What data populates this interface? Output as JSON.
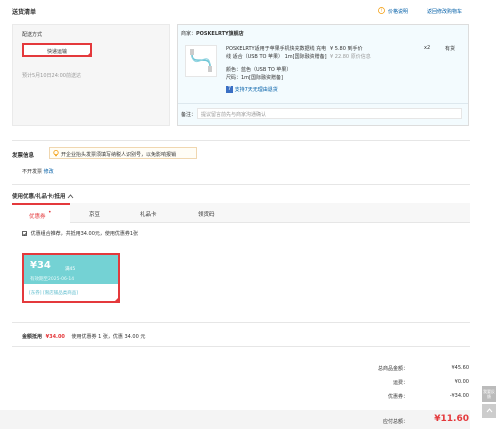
{
  "header": {
    "title": "送货清单",
    "price_note": "价格说明",
    "back_to_cart": "返回修改购物车"
  },
  "delivery": {
    "label": "配送方式",
    "method": "快递运输",
    "estimate": "预计5月10日24:00前送达"
  },
  "shop": {
    "label": "商家：",
    "name": "POSKELRTY旗舰店",
    "product": {
      "title_line1": "POSKELRTY适用于苹果手机快充数据线 充电",
      "title_line2": "线 适合（USB TO 苹果） 1m[国际融资赠备]",
      "color": "颜色：蓝色（USB TO 苹果）",
      "spec": "尺码：1m[国际融资赠备]",
      "return_policy": "支持7天无理由退货",
      "price": "¥ 5.80",
      "price_note": "到手价",
      "orig_price": "¥ 22.80",
      "orig_note": "原价信息",
      "qty": "x2",
      "stock": "有货"
    },
    "note_label": "备注：",
    "note_placeholder": "提议留言前先与商家沟通确认"
  },
  "invoice": {
    "title": "发票信息",
    "tip": "开企业抬头发票须填写纳税人识别号，以免影响报销",
    "status": "不开发票",
    "edit": "修改"
  },
  "coupons": {
    "title": "使用优惠/礼品卡/抵用",
    "toggle_icon": "chevron-up-icon",
    "tabs": [
      "优惠券",
      "京豆",
      "礼品卡",
      "领货码"
    ],
    "active_tab_badge": "•",
    "checkbox_label": "优惠组合推荐，共抵用34.00元，使用优惠券1张",
    "card": {
      "amount": "¥34",
      "condition": "满45",
      "validity": "有效期至2025-06-14",
      "tag1": "[东券]",
      "tag2": "[限店铺品类商品]"
    },
    "summary_label": "金额抵用",
    "summary_amount": "¥34.00",
    "summary_detail": "使用优惠券 1 张，优惠 34.00 元"
  },
  "totals": {
    "goods_label": "总商品金额：",
    "goods_value": "¥45.60",
    "freight_label": "运费：",
    "freight_value": "¥0.00",
    "discount_label": "优惠券：",
    "discount_value": "-¥34.00",
    "payable_label": "应付总额：",
    "payable_value": "¥11.60"
  },
  "side": {
    "feedback": "我要反馈",
    "top": "^"
  },
  "colors": {
    "red": "#e4393c",
    "blue": "#005ea7",
    "teal": "#74d2d4",
    "panel": "#f3fbfe",
    "orange": "#f39800"
  }
}
